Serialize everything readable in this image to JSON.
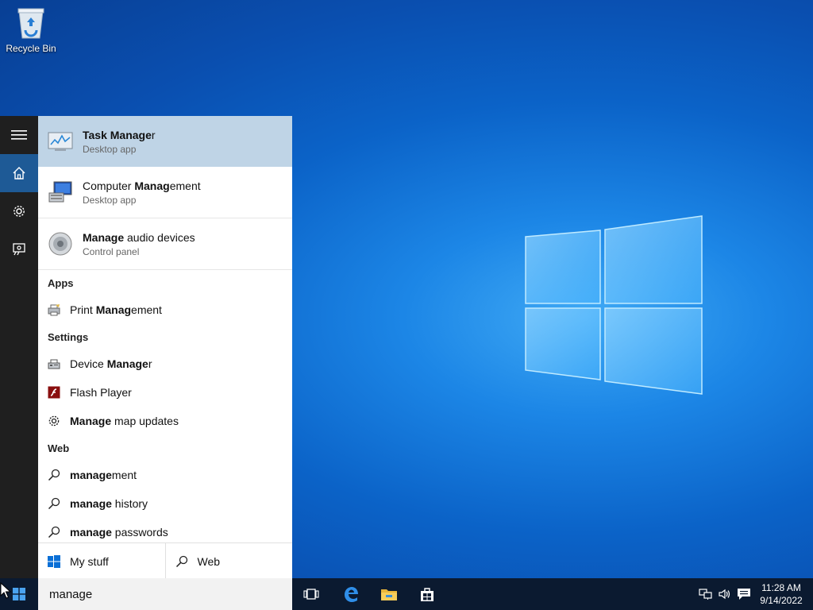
{
  "desktop": {
    "recycle_bin_label": "Recycle Bin"
  },
  "rail": {
    "icons": [
      "hamburger-menu-icon",
      "home-icon",
      "settings-gear-icon",
      "feedback-icon"
    ]
  },
  "best_matches": [
    {
      "title_bold": "Task Manage",
      "title_rest": "r",
      "subtitle": "Desktop app",
      "icon": "task-manager-icon",
      "selected": true
    },
    {
      "title_pre": "Computer ",
      "title_bold": "Manag",
      "title_rest": "ement",
      "subtitle": "Desktop app",
      "icon": "computer-management-icon"
    },
    {
      "title_bold": "Manage",
      "title_rest": " audio devices",
      "subtitle": "Control panel",
      "icon": "speaker-icon"
    }
  ],
  "sections": {
    "apps": "Apps",
    "settings": "Settings",
    "web": "Web"
  },
  "apps": [
    {
      "pre": "Print ",
      "bold": "Manag",
      "rest": "ement",
      "icon": "print-management-icon"
    }
  ],
  "settings": [
    {
      "pre": "Device ",
      "bold": "Manage",
      "rest": "r",
      "icon": "device-manager-icon"
    },
    {
      "pre": "",
      "bold": "",
      "rest": "Flash Player",
      "icon": "flash-player-icon"
    },
    {
      "pre": "",
      "bold": "Manage",
      "rest": " map updates",
      "icon": "gear-icon"
    }
  ],
  "web": [
    {
      "bold": "manage",
      "rest": "ment",
      "icon": "search-icon"
    },
    {
      "bold": "manage",
      "rest": " history",
      "icon": "search-icon"
    },
    {
      "bold": "manage",
      "rest": " passwords",
      "icon": "search-icon"
    }
  ],
  "filters": {
    "my_stuff": "My stuff",
    "web": "Web"
  },
  "search": {
    "value": "manage"
  },
  "taskbar": {
    "time": "11:28 AM",
    "date": "9/14/2022",
    "colors": {
      "accent": "#1e5a96",
      "taskbar": "#0b1a30"
    }
  }
}
